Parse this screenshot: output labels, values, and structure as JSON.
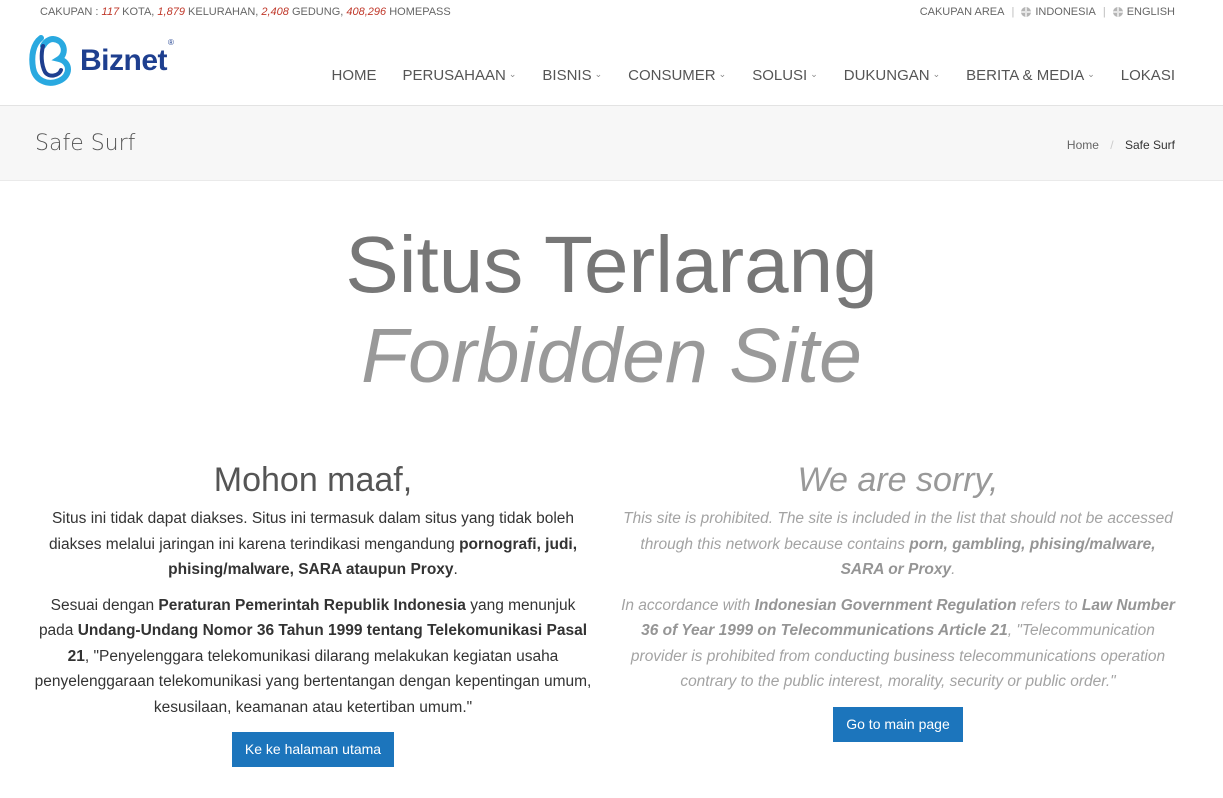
{
  "topbar": {
    "coverage_label": "CAKUPAN :",
    "kota_value": "117",
    "kota_label": "KOTA,",
    "kelurahan_value": "1,879",
    "kelurahan_label": "KELURAHAN,",
    "gedung_value": "2,408",
    "gedung_label": "GEDUNG,",
    "homepass_value": "408,296",
    "homepass_label": "HOMEPASS",
    "links": {
      "coverage_area": "CAKUPAN AREA",
      "indonesia": "INDONESIA",
      "english": "ENGLISH"
    },
    "separator": "|"
  },
  "header": {
    "logo_text": "Biznet",
    "logo_mark": "®",
    "brand_color": "#1e3f8f",
    "accent_color": "#29a9e0",
    "nav": [
      {
        "label": "HOME",
        "dropdown": false
      },
      {
        "label": "PERUSAHAAN",
        "dropdown": true
      },
      {
        "label": "BISNIS",
        "dropdown": true
      },
      {
        "label": "CONSUMER",
        "dropdown": true
      },
      {
        "label": "SOLUSI",
        "dropdown": true
      },
      {
        "label": "DUKUNGAN",
        "dropdown": true
      },
      {
        "label": "BERITA & MEDIA",
        "dropdown": true
      },
      {
        "label": "LOKASI",
        "dropdown": false
      }
    ],
    "caret_icon": "chevron-down-icon"
  },
  "titlebar": {
    "title": "Safe Surf",
    "breadcrumb_home": "Home",
    "breadcrumb_sep": "/",
    "breadcrumb_current": "Safe Surf"
  },
  "hero": {
    "line1": "Situs Terlarang",
    "line2": "Forbidden Site"
  },
  "left": {
    "heading": "Mohon maaf,",
    "p1_a": "Situs ini tidak dapat diakses. Situs ini termasuk dalam situs yang tidak boleh diakses melalui jaringan ini karena terindikasi mengandung ",
    "p1_b": "pornografi, judi, phising/malware, SARA ataupun Proxy",
    "p1_c": ".",
    "p2_a": "Sesuai dengan ",
    "p2_b": "Peraturan Pemerintah Republik Indonesia",
    "p2_c": " yang menunjuk pada ",
    "p2_d": "Undang-Undang Nomor 36 Tahun 1999 tentang Telekomunikasi Pasal 21",
    "p2_e": ", \"Penyelenggara telekomunikasi dilarang melakukan kegiatan usaha penyelenggaraan telekomunikasi yang bertentangan dengan kepentingan umum, kesusilaan, keamanan atau ketertiban umum.\"",
    "button": "Ke ke halaman utama"
  },
  "right": {
    "heading": "We are sorry,",
    "p1_a": "This site is prohibited. The site is included in the list that should not be accessed through this network because contains ",
    "p1_b": "porn, gambling, phising/malware, SARA or Proxy",
    "p1_c": ".",
    "p2_a": "In accordance with ",
    "p2_b": "Indonesian Government Regulation",
    "p2_c": " refers to ",
    "p2_d": "Law Number 36 of Year 1999 on Telecommunications Article 21",
    "p2_e": ", \"Telecommunication provider is prohibited from conducting business telecommunications operation contrary to the public interest, morality, security or public order.\"",
    "button": "Go to main page"
  },
  "colors": {
    "button": "#1c75bc",
    "coverage_number": "#c0392b"
  }
}
